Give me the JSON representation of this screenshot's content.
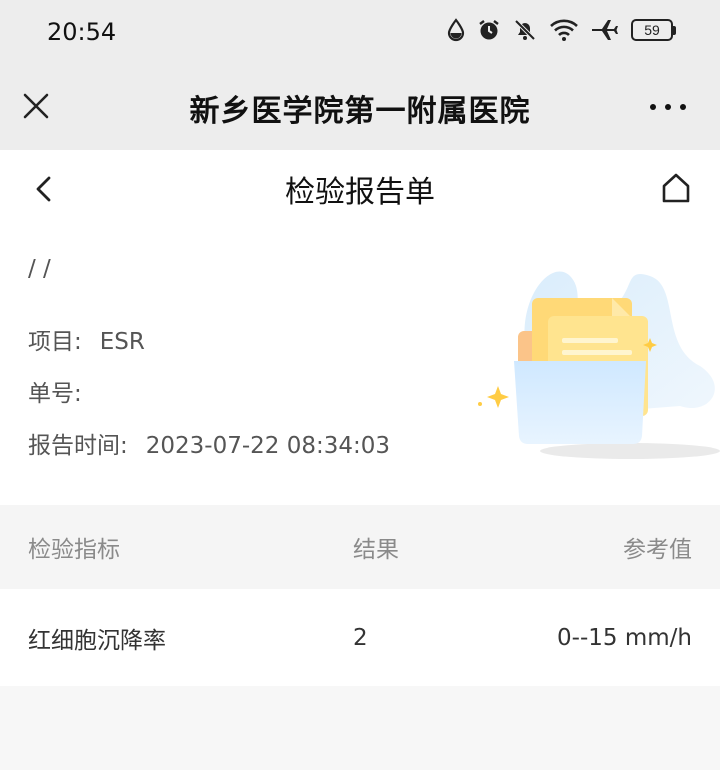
{
  "status_bar": {
    "time": "20:54",
    "battery": "59"
  },
  "title_bar": {
    "title": "新乡医学院第一附属医院"
  },
  "sub_header": {
    "title": "检验报告单"
  },
  "report": {
    "patient_line": "/ /",
    "item_label": "项目:",
    "item_value": "ESR",
    "number_label": "单号:",
    "number_value": "",
    "time_label": "报告时间:",
    "time_value": "2023-07-22 08:34:03"
  },
  "table": {
    "headers": {
      "name": "检验指标",
      "result": "结果",
      "reference": "参考值"
    },
    "rows": [
      {
        "name": "红细胞沉降率",
        "result": "2",
        "reference": "0--15 mm/h"
      }
    ]
  }
}
